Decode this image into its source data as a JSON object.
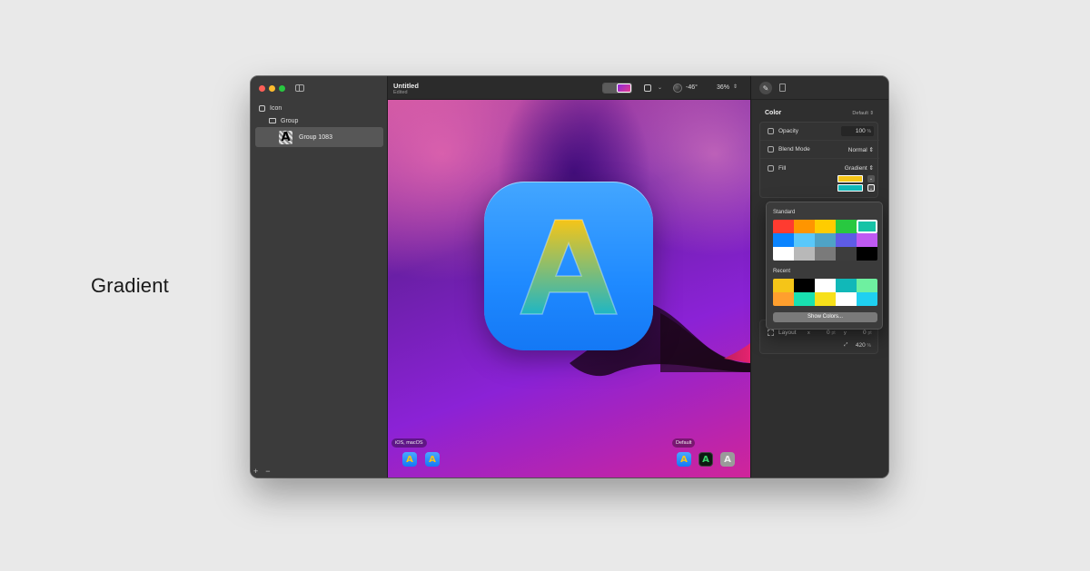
{
  "caption": "Gradient",
  "sidebar": {
    "items": [
      {
        "label": "Icon"
      },
      {
        "label": "Group"
      },
      {
        "label": "Group 1083"
      }
    ],
    "footer": {
      "add": "+",
      "remove": "−"
    }
  },
  "toolbar": {
    "title": "Untitled",
    "subtitle": "Edited",
    "angle": "-46°",
    "zoom": "36%"
  },
  "canvas": {
    "icon_letter": "A",
    "presets_left_label": "iOS, macOS",
    "presets_right_label": "Default"
  },
  "inspector": {
    "section_title": "Color",
    "section_option": "Default",
    "rows": {
      "opacity_label": "Opacity",
      "opacity_value": "100",
      "opacity_unit": "%",
      "blend_label": "Blend Mode",
      "blend_value": "Normal",
      "fill_label": "Fill",
      "fill_value": "Gradient"
    },
    "layout": {
      "label": "Layout",
      "x_label": "x",
      "x_value": "0",
      "y_label": "y",
      "y_value": "0",
      "unit": "pt",
      "scale_value": "420",
      "scale_unit": "%"
    },
    "fill_colors": [
      "#f5c518",
      "#11b8b8"
    ]
  },
  "popover": {
    "standard_label": "Standard",
    "recent_label": "Recent",
    "show_colors_label": "Show Colors...",
    "standard_colors": [
      "#ff3b30",
      "#ff9500",
      "#ffcc00",
      "#28c840",
      "#17c3a6",
      "#0a84ff",
      "#5ac8fa",
      "#4fa3c6",
      "#5e5ce6",
      "#bf5af2",
      "#ffffff",
      "#b8b8b8",
      "#7a7a7a",
      "#3d3d3d",
      "#000000"
    ],
    "recent_colors": [
      "#f5c518",
      "#000000",
      "#ffffff",
      "#11b8b8",
      "#6ef0a0",
      "#ff9f2e",
      "#19e0b0",
      "#f7e01a",
      "#ffffff",
      "#1fd0f0"
    ]
  }
}
